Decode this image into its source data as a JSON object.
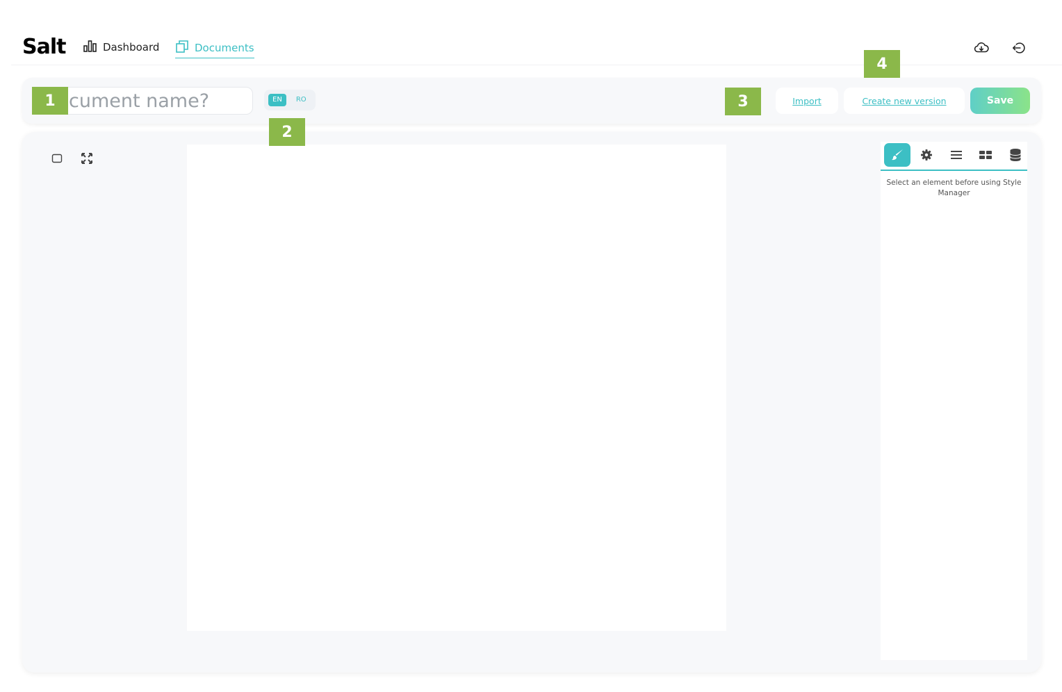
{
  "header": {
    "logo": "Salt",
    "nav": [
      {
        "label": "Dashboard",
        "icon": "bar-chart-icon",
        "active": false
      },
      {
        "label": "Documents",
        "icon": "documents-icon",
        "active": true
      }
    ],
    "icons": [
      "cloud-download-icon",
      "logout-icon"
    ]
  },
  "toolbar": {
    "name_placeholder": "cument name?",
    "languages": [
      "EN",
      "RO"
    ],
    "active_language": "EN",
    "import_label": "Import",
    "new_version_label": "Create new version",
    "save_label": "Save"
  },
  "editor": {
    "left_tools": [
      "square-icon",
      "fullscreen-icon"
    ],
    "panel_tabs": [
      "brush-icon",
      "gear-icon",
      "menu-icon",
      "blocks-icon",
      "database-icon"
    ],
    "panel_message": "Select an element before using Style Manager"
  },
  "markers": [
    "1",
    "2",
    "3",
    "4"
  ],
  "colors": {
    "accent": "#3cbfc4",
    "marker": "#8bb84a",
    "save_gradient_end": "#8be389"
  }
}
